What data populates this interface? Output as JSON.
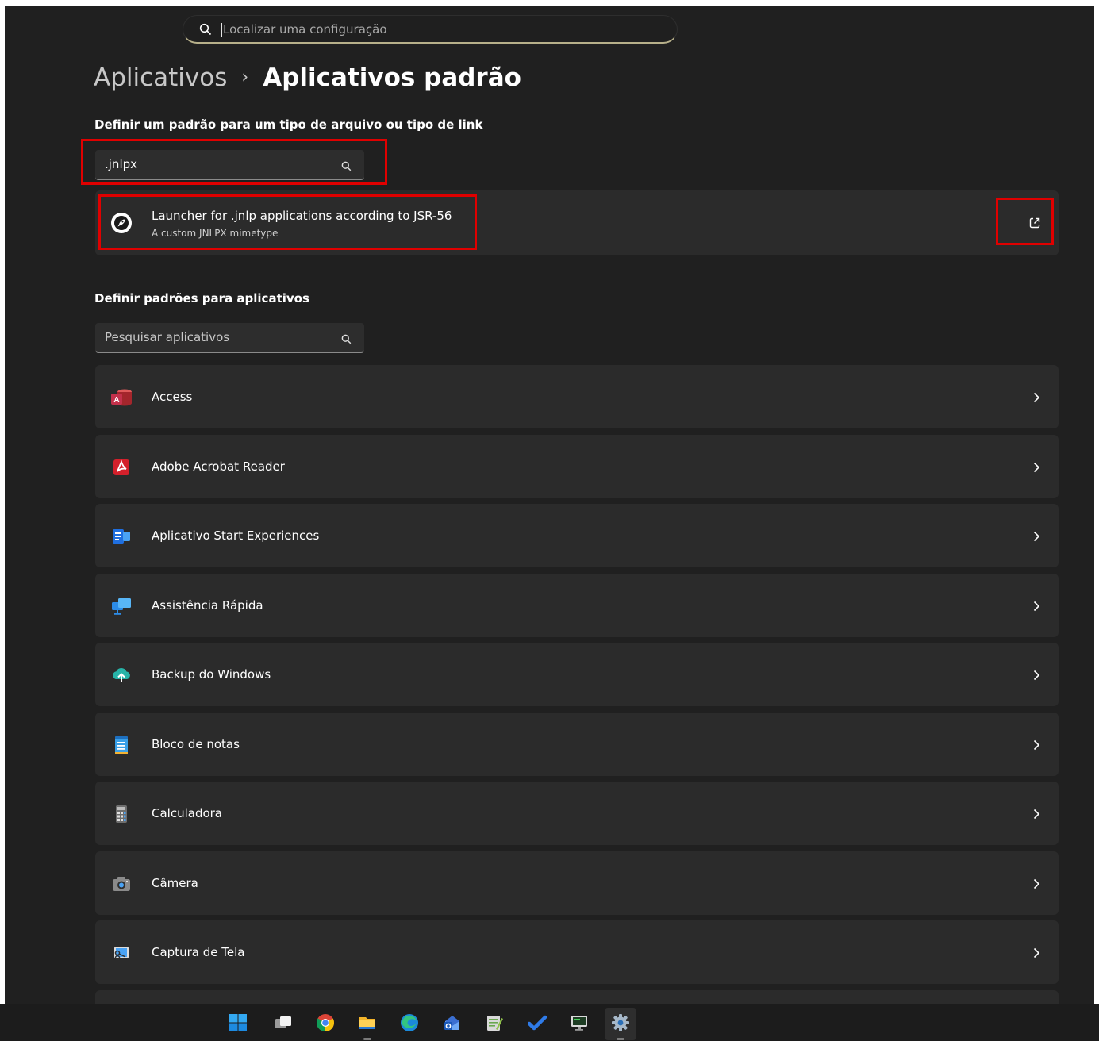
{
  "top_search": {
    "placeholder": "Localizar uma configuração"
  },
  "breadcrumb": {
    "parent": "Aplicativos",
    "separator": "›",
    "current": "Aplicativos padrão"
  },
  "filetype_section": {
    "title": "Definir um padrão para um tipo de arquivo ou tipo de link",
    "search_value": ".jnlpx",
    "result": {
      "name": "Launcher for .jnlp applications according to JSR-56",
      "description": "A custom JNLPX mimetype",
      "icon": "rocket-icon",
      "action_icon": "open-external-icon"
    }
  },
  "apps_section": {
    "title": "Definir padrões para aplicativos",
    "search_placeholder": "Pesquisar aplicativos",
    "apps": [
      {
        "label": "Access",
        "icon": "access-icon"
      },
      {
        "label": "Adobe Acrobat Reader",
        "icon": "acrobat-icon"
      },
      {
        "label": "Aplicativo Start Experiences",
        "icon": "start-experiences-icon"
      },
      {
        "label": "Assistência Rápida",
        "icon": "quick-assist-icon"
      },
      {
        "label": "Backup do Windows",
        "icon": "backup-icon"
      },
      {
        "label": "Bloco de notas",
        "icon": "notepad-icon"
      },
      {
        "label": "Calculadora",
        "icon": "calculator-icon"
      },
      {
        "label": "Câmera",
        "icon": "camera-icon"
      },
      {
        "label": "Captura de Tela",
        "icon": "snipping-tool-icon"
      }
    ]
  },
  "taskbar": {
    "items": [
      {
        "icon": "windows-start-icon",
        "active": false
      },
      {
        "icon": "task-view-icon",
        "active": false
      },
      {
        "icon": "chrome-icon",
        "active": false
      },
      {
        "icon": "file-explorer-icon",
        "active": false
      },
      {
        "icon": "edge-icon",
        "active": false
      },
      {
        "icon": "outlook-icon",
        "active": false
      },
      {
        "icon": "notepad-plus-icon",
        "active": false
      },
      {
        "icon": "todo-icon",
        "active": false
      },
      {
        "icon": "terminal-monitor-icon",
        "active": false
      },
      {
        "icon": "settings-gear-icon",
        "active": true
      }
    ]
  },
  "colors": {
    "window_bg": "#202020",
    "card_bg": "#2b2b2b",
    "highlight": "#e00000",
    "accent_underline": "#b7b08a"
  }
}
